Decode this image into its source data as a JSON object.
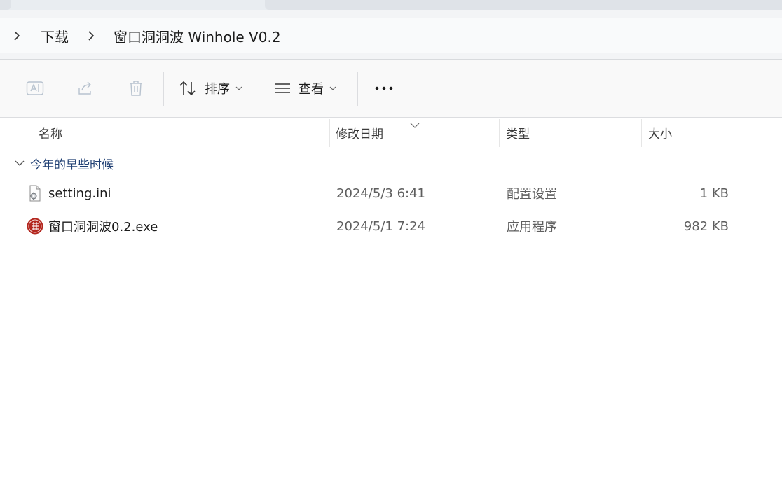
{
  "breadcrumb": {
    "items": [
      "下载",
      "窗口洞洞波 Winhole V0.2"
    ]
  },
  "toolbar": {
    "sort_label": "排序",
    "view_label": "查看",
    "more_label": "•••"
  },
  "columns": {
    "name": "名称",
    "modified": "修改日期",
    "type": "类型",
    "size": "大小"
  },
  "group": {
    "label": "今年的早些时候"
  },
  "files": [
    {
      "name": "setting.ini",
      "modified": "2024/5/3 6:41",
      "type": "配置设置",
      "size": "1 KB",
      "icon": "ini-file-icon"
    },
    {
      "name": "窗口洞洞波0.2.exe",
      "modified": "2024/5/1 7:24",
      "type": "应用程序",
      "size": "982 KB",
      "icon": "app-exe-icon"
    }
  ],
  "colors": {
    "group_text": "#1f3f73",
    "app_icon_red": "#b3261e"
  }
}
